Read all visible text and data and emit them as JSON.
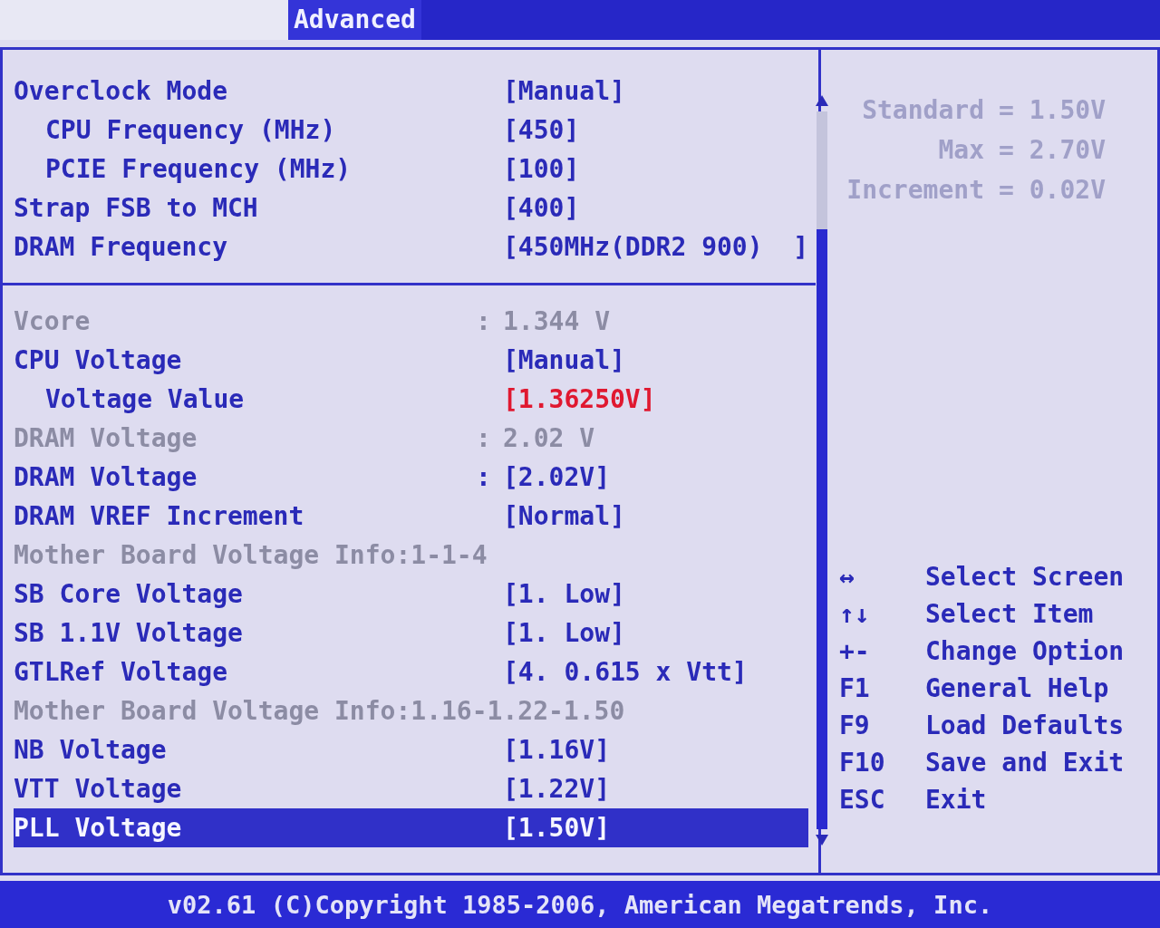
{
  "tabs": [
    {
      "label": "Advanced",
      "selected": true
    }
  ],
  "settings": [
    [
      {
        "kind": "setting",
        "label": "Overclock Mode",
        "value": "[Manual]",
        "indented": false,
        "warning": false,
        "selected": false
      },
      {
        "kind": "setting",
        "label": "CPU Frequency (MHz)",
        "value": "[450]",
        "indented": true,
        "warning": false,
        "selected": false
      },
      {
        "kind": "setting",
        "label": "PCIE Frequency (MHz)",
        "value": "[100]",
        "indented": true,
        "warning": false,
        "selected": false
      },
      {
        "kind": "setting",
        "label": "Strap FSB to MCH",
        "value": "[400]",
        "indented": false,
        "warning": false,
        "selected": false
      },
      {
        "kind": "setting",
        "label": "DRAM Frequency",
        "value": "[450MHz(DDR2 900)  ]",
        "indented": false,
        "warning": false,
        "selected": false
      }
    ],
    [
      {
        "kind": "info",
        "label": "Vcore",
        "separator": ":",
        "value": "1.344 V",
        "indented": false,
        "warning": false,
        "selected": false
      },
      {
        "kind": "setting",
        "label": "CPU Voltage",
        "value": "[Manual]",
        "indented": false,
        "warning": false,
        "selected": false
      },
      {
        "kind": "setting",
        "label": "Voltage Value",
        "value": "[1.36250V]",
        "indented": true,
        "warning": true,
        "selected": false
      },
      {
        "kind": "info",
        "label": "DRAM Voltage",
        "separator": ":",
        "value": "2.02 V",
        "indented": false,
        "warning": false,
        "selected": false
      },
      {
        "kind": "setting",
        "label": "DRAM Voltage",
        "separator": ":",
        "value": "[2.02V]",
        "indented": false,
        "warning": false,
        "selected": false
      },
      {
        "kind": "setting",
        "label": "DRAM VREF Increment",
        "value": "[Normal]",
        "indented": false,
        "warning": false,
        "selected": false
      },
      {
        "kind": "heading",
        "label": "Mother Board Voltage Info:1-1-4"
      },
      {
        "kind": "setting",
        "label": "SB Core Voltage",
        "value": "[1. Low]",
        "indented": false,
        "warning": false,
        "selected": false
      },
      {
        "kind": "setting",
        "label": "SB 1.1V Voltage",
        "value": "[1. Low]",
        "indented": false,
        "warning": false,
        "selected": false
      },
      {
        "kind": "setting",
        "label": "GTLRef Voltage",
        "value": "[4. 0.615 x Vtt]",
        "indented": false,
        "warning": false,
        "selected": false
      },
      {
        "kind": "heading",
        "label": "Mother Board Voltage Info:1.16-1.22-1.50"
      },
      {
        "kind": "setting",
        "label": "NB Voltage",
        "value": "[1.16V]",
        "indented": false,
        "warning": false,
        "selected": false
      },
      {
        "kind": "setting",
        "label": "VTT Voltage",
        "value": "[1.22V]",
        "indented": false,
        "warning": false,
        "selected": false
      },
      {
        "kind": "setting",
        "label": "PLL Voltage",
        "value": "[1.50V]",
        "indented": false,
        "warning": false,
        "selected": true
      }
    ]
  ],
  "help": [
    {
      "label": "Standard",
      "value": "= 1.50V"
    },
    {
      "label": "Max",
      "value": "= 2.70V"
    },
    {
      "label": "Increment",
      "value": "= 0.02V"
    }
  ],
  "keys": [
    {
      "key": "↔",
      "action": "Select Screen"
    },
    {
      "key": "↑↓",
      "action": "Select Item"
    },
    {
      "key": "+-",
      "action": "Change Option"
    },
    {
      "key": "F1",
      "action": "General Help"
    },
    {
      "key": "F9",
      "action": "Load Defaults"
    },
    {
      "key": "F10",
      "action": "Save and Exit"
    },
    {
      "key": "ESC",
      "action": "Exit"
    }
  ],
  "status_bar": "v02.61 (C)Copyright 1985-2006, American Megatrends, Inc."
}
